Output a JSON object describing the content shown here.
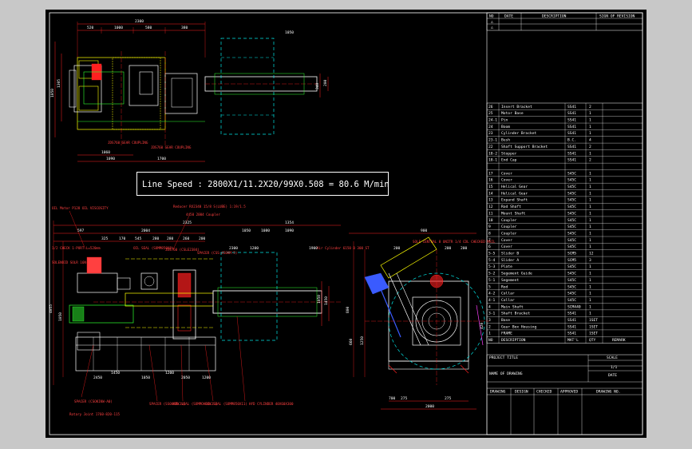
{
  "revision_header": {
    "no": "NO",
    "date": "DATE",
    "description": "DESCRIPTION",
    "sign": "SIGN OF REVISION",
    "rows": [
      "△",
      "△"
    ]
  },
  "line_speed": "Line Speed : 2800X1/11.2X20/99X0.508 = 80.6 M/min",
  "parts": [
    {
      "no": "26",
      "desc": "Insert Bracket",
      "mat": "SS41",
      "qty": "2"
    },
    {
      "no": "25",
      "desc": "Motor Base",
      "mat": "SS41",
      "qty": "1"
    },
    {
      "no": "24-1",
      "desc": "Pin",
      "mat": "SS41",
      "qty": "1"
    },
    {
      "no": "24",
      "desc": "Boom",
      "mat": "SS41",
      "qty": "1"
    },
    {
      "no": "23",
      "desc": "Cylinder Bracket",
      "mat": "SS41",
      "qty": "1"
    },
    {
      "no": "23-1",
      "desc": "Bush",
      "mat": "B.C.",
      "qty": "4"
    },
    {
      "no": "22",
      "desc": "Shaft Support Bracket",
      "mat": "SS41",
      "qty": "2"
    },
    {
      "no": "18-2",
      "desc": "Stopper",
      "mat": "SS41",
      "qty": "1"
    },
    {
      "no": "18-1",
      "desc": "End Cap",
      "mat": "SS41",
      "qty": "2"
    },
    {
      "no": "",
      "desc": "",
      "mat": "",
      "qty": ""
    },
    {
      "no": "17",
      "desc": "Cover",
      "mat": "S45C",
      "qty": "1"
    },
    {
      "no": "16",
      "desc": "Cover",
      "mat": "S45C",
      "qty": "1"
    },
    {
      "no": "15",
      "desc": "Helical Gear",
      "mat": "S45C",
      "qty": "1"
    },
    {
      "no": "14",
      "desc": "Helical Gear",
      "mat": "S45C",
      "qty": "1"
    },
    {
      "no": "13",
      "desc": "Expand Shaft",
      "mat": "S45C",
      "qty": "1"
    },
    {
      "no": "12",
      "desc": "Rod Shaft",
      "mat": "S45C",
      "qty": "1"
    },
    {
      "no": "11",
      "desc": "Mount Shaft",
      "mat": "S45C",
      "qty": "1"
    },
    {
      "no": "10",
      "desc": "Coupler",
      "mat": "S45C",
      "qty": "1"
    },
    {
      "no": "9",
      "desc": "Coupler",
      "mat": "S45C",
      "qty": "1"
    },
    {
      "no": "8",
      "desc": "Coupler",
      "mat": "S45C",
      "qty": "1"
    },
    {
      "no": "7",
      "desc": "Cover",
      "mat": "S45C",
      "qty": "1"
    },
    {
      "no": "6",
      "desc": "Cover",
      "mat": "S45C",
      "qty": "1"
    },
    {
      "no": "5-5",
      "desc": "Slider B",
      "mat": "SCM5",
      "qty": "12"
    },
    {
      "no": "5-4",
      "desc": "Slider A",
      "mat": "SCM5",
      "qty": "3"
    },
    {
      "no": "5-3",
      "desc": "Plate",
      "mat": "S45C",
      "qty": "1"
    },
    {
      "no": "5-2",
      "desc": "Segement Guide",
      "mat": "S45C",
      "qty": "1"
    },
    {
      "no": "5-1",
      "desc": "Segement",
      "mat": "S45C",
      "qty": "1"
    },
    {
      "no": "5",
      "desc": "Rod",
      "mat": "S45C",
      "qty": "1"
    },
    {
      "no": "4-2",
      "desc": "Collar",
      "mat": "S45C",
      "qty": "1"
    },
    {
      "no": "4-1",
      "desc": "Collar",
      "mat": "S45C",
      "qty": "1"
    },
    {
      "no": "4",
      "desc": "Main Shaft",
      "mat": "SCM440",
      "qty": "1"
    },
    {
      "no": "3-1",
      "desc": "Shaft Bracket",
      "mat": "SS41",
      "qty": "1"
    },
    {
      "no": "3",
      "desc": "Base",
      "mat": "SS41",
      "qty": "1SET"
    },
    {
      "no": "2",
      "desc": "Gear Box Housing",
      "mat": "SS41",
      "qty": "1SET"
    },
    {
      "no": "1",
      "desc": "FRAME",
      "mat": "SS41",
      "qty": "1SET"
    }
  ],
  "parts_header": {
    "no": "NO",
    "desc": "DESCRIPTION",
    "mat": "MAT'L",
    "qty": "QTY",
    "remark": "REMARK"
  },
  "title_block": {
    "project": "PROJECT TITLE",
    "scale_label": "SCALE",
    "scale_value": "1/1",
    "name": "NAME OF DRAWING",
    "date_label": "DATE",
    "drawing": "DRAWING",
    "design": "DESIGN",
    "checked": "CHECKED",
    "approved": "APPROVED",
    "dwg_no": "DRAWING NO."
  },
  "dims_top": [
    "2300",
    "520",
    "1000",
    "580",
    "380",
    "1050",
    "1305",
    "1090",
    "1700",
    "1060",
    "340",
    "200",
    "1050"
  ],
  "labels_top": [
    "JDS760 GEAR COUPLING",
    "JDS760 GEAR COUPLING"
  ],
  "dims_side": [
    "2325",
    "1354",
    "597",
    "2004",
    "325",
    "170",
    "545",
    "280",
    "280",
    "260",
    "200",
    "1050",
    "1080",
    "1090",
    "4055",
    "1050",
    "2300",
    "1050",
    "1450",
    "2450",
    "1050",
    "2050",
    "1200",
    "1450",
    "1200",
    "1200",
    "1900"
  ],
  "labels_side": [
    "OIL Motor P128 OIL VISCOSITY",
    "Reducer RX2340 15/8 S(LUBE) 1:19/1.5",
    "1/2 CHECK 1-PORT L=520mm",
    "OIL SEAL (SOMM850X8)",
    "JDS760 (CSLE2384)",
    "4450 2004 Coupler",
    "SPACER (CSS-450KM-5)",
    "SPACER (CSOKIKW-A0)",
    "SPACER (SS00KMX1x)",
    "OIL SEAL (SOMMOH1OX1S)",
    "OIL SEAL (SOMM850X11)",
    "HYD CYLINDER 40X60X300",
    "Rotary Joint 1760-820-115",
    "SOLENOID SOLR 16N-1",
    "Air Cylinder 6150 B 300 ST",
    "SOLE CENTRAL 8 UNITR 1/4 CDL CHECKED MAIL"
  ],
  "dims_end": [
    "2000",
    "700",
    "275",
    "275",
    "900",
    "660",
    "1250",
    "420",
    "200",
    "200",
    "200",
    "800"
  ],
  "color_frame": "#ffffff",
  "color_red": "#ff2020",
  "color_yellow": "#ffff00",
  "color_green": "#30ff30",
  "color_cyan": "#00e6e6",
  "color_blue": "#3a5bff",
  "color_magenta": "#ff40ff"
}
